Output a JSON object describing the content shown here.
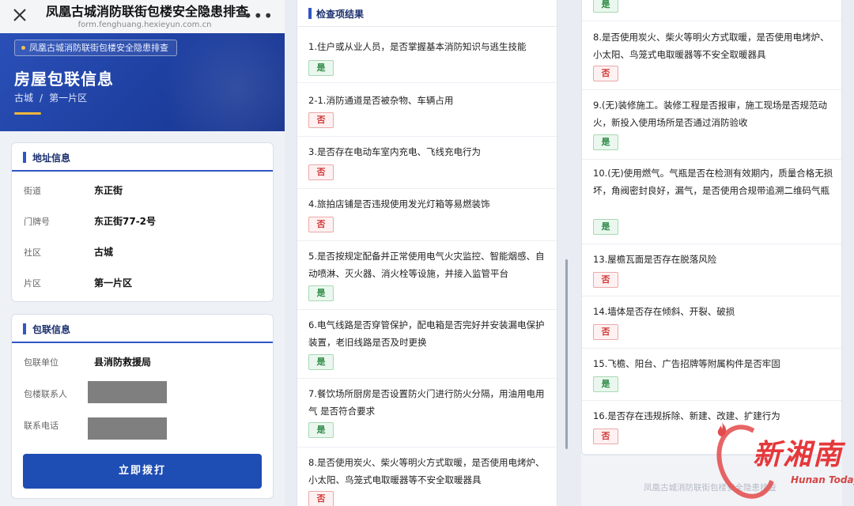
{
  "app": {
    "title": "凤凰古城消防联街包楼安全隐患排查",
    "url": "form.fenghuang.hexieyun.com.cn",
    "more": "•••"
  },
  "banner": {
    "tag": "凤凰古城消防联街包楼安全隐患排查",
    "title": "房屋包联信息",
    "crumbs": [
      "古城",
      "第一片区"
    ],
    "crumb_sep": "/"
  },
  "address": {
    "title": "地址信息",
    "rows": [
      {
        "label": "街道",
        "value": "东正街"
      },
      {
        "label": "门牌号",
        "value": "东正街77-2号"
      },
      {
        "label": "社区",
        "value": "古城"
      },
      {
        "label": "片区",
        "value": "第一片区"
      }
    ]
  },
  "contact": {
    "title": "包联信息",
    "unit_label": "包联单位",
    "unit_value": "县消防救援局",
    "person_label": "包楼联系人",
    "phone_label": "联系电话",
    "call_button": "立即拨打"
  },
  "results": {
    "title": "检查项结果",
    "yes": "是",
    "no": "否",
    "middle": [
      {
        "q": "1.住户或从业人员，是否掌握基本消防知识与逃生技能",
        "a": "yes"
      },
      {
        "q": "2-1.消防通道是否被杂物、车辆占用",
        "a": "no"
      },
      {
        "q": "3.是否存在电动车室内充电、飞线充电行为",
        "a": "no"
      },
      {
        "q": "4.旅拍店铺是否违规使用发光灯箱等易燃装饰",
        "a": "no"
      },
      {
        "q": "5.是否按规定配备并正常使用电气火灾监控、智能烟感、自动喷淋、灭火器、消火栓等设施，并接入监管平台",
        "a": "yes"
      },
      {
        "q": "6.电气线路是否穿管保护，配电箱是否完好并安装漏电保护装置，老旧线路是否及时更换",
        "a": "yes"
      },
      {
        "q": "7.餐饮场所厨房是否设置防火门进行防火分隔，用油用电用气 是否符合要求",
        "a": "yes"
      },
      {
        "q": "8.是否使用炭火、柴火等明火方式取暖，是否使用电烤炉、小太阳、鸟笼式电取暖器等不安全取暖器具",
        "a": "no"
      }
    ],
    "right_top_badge": "yes",
    "right": [
      {
        "q": "8.是否使用炭火、柴火等明火方式取暖，是否使用电烤炉、小太阳、鸟笼式电取暖器等不安全取暖器具",
        "a": "no"
      },
      {
        "q": "9.(无)装修施工。装修工程是否报审，施工现场是否规范动火，新投入使用场所是否通过消防验收",
        "a": "yes"
      },
      {
        "q": "10.(无)使用燃气。气瓶是否在检测有效期内，质量合格无损坏，角阀密封良好，漏气，是否使用合规带追溯二维码气瓶",
        "a": "yes"
      },
      {
        "q": "13.屋檐瓦面是否存在脱落风险",
        "a": "no"
      },
      {
        "q": "14.墙体是否存在倾斜、开裂、破损",
        "a": "no"
      },
      {
        "q": "15.飞檐、阳台、广告招牌等附属构件是否牢固",
        "a": "yes"
      },
      {
        "q": "16.是否存在违规拆除、新建、改建、扩建行为",
        "a": "no"
      }
    ],
    "footer": "凤凰古城消防联街包楼安全隐患排查"
  },
  "watermark": {
    "text": "新湘南",
    "sub": "Hunan Today"
  },
  "colors": {
    "primary": "#1e4db3",
    "banner": "#2a50b8",
    "accent": "#f0b63c",
    "yes": "#2e8b47",
    "no": "#d23a3a"
  }
}
